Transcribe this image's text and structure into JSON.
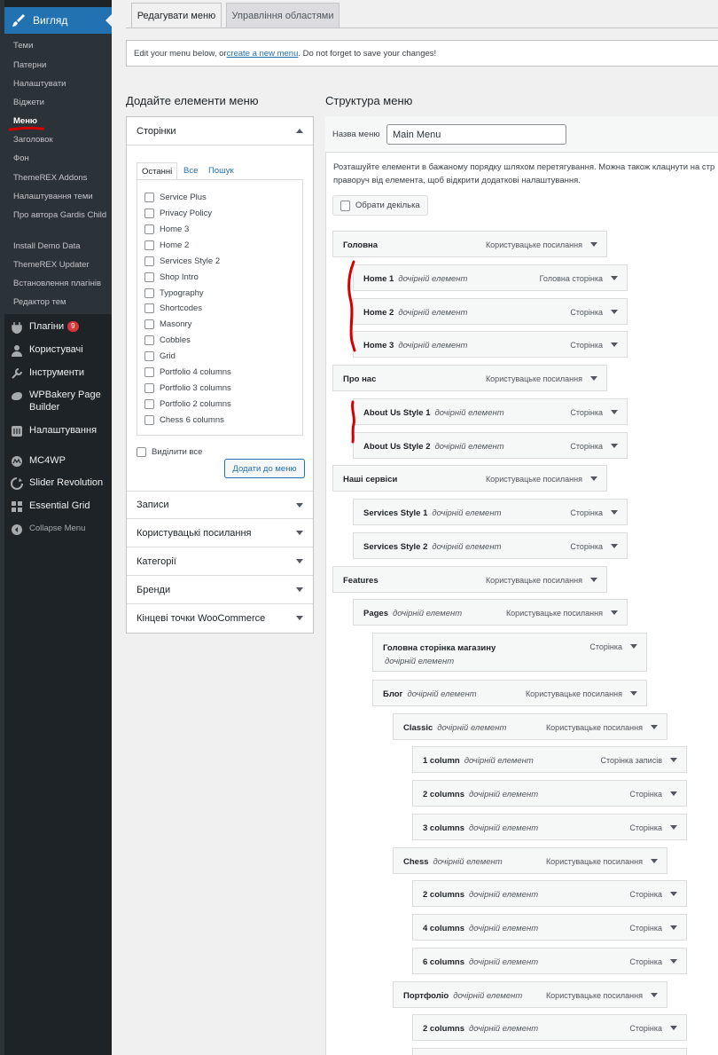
{
  "sidebar": {
    "current": "Вигляд",
    "submenu": [
      "Теми",
      "Патерни",
      "Налаштувати",
      "Віджети",
      "Меню",
      "Заголовок",
      "Фон",
      "ThemeREX Addons",
      "Налаштування теми",
      "Про автора Gardis Child",
      "Install Demo Data",
      "ThemeREX Updater",
      "Встановлення плагінів",
      "Редактор тем"
    ],
    "items": [
      {
        "label": "Плагіни",
        "badge": "9",
        "icon": "plugin-icon"
      },
      {
        "label": "Користувачі",
        "icon": "users-icon"
      },
      {
        "label": "Інструменти",
        "icon": "tools-icon"
      },
      {
        "label": "WPBakery Page Builder",
        "icon": "wpbakery-icon"
      },
      {
        "label": "Налаштування",
        "icon": "settings-icon"
      },
      {
        "label": "MC4WP",
        "icon": "mc4wp-icon"
      },
      {
        "label": "Slider Revolution",
        "icon": "slider-icon"
      },
      {
        "label": "Essential Grid",
        "icon": "grid-icon"
      },
      {
        "label": "Collapse Menu",
        "icon": "collapse-icon"
      }
    ]
  },
  "tabs": [
    "Редагувати меню",
    "Управління областями"
  ],
  "notice": {
    "before": "Edit your menu below, or ",
    "link": "create a new menu",
    "after": ". Do not forget to save your changes!"
  },
  "left": {
    "title": "Додайте елементи меню",
    "pages_header": "Сторінки",
    "inner_tabs": [
      "Останні",
      "Все",
      "Пошук"
    ],
    "pages": [
      "Service Plus",
      "Privacy Policy",
      "Home 3",
      "Home 2",
      "Services Style 2",
      "Shop Intro",
      "Typography",
      "Shortcodes",
      "Masonry",
      "Cobbles",
      "Grid",
      "Portfolio 4 columns",
      "Portfolio 3 columns",
      "Portfolio 2 columns",
      "Chess 6 columns"
    ],
    "select_all": "Виділити все",
    "add_button": "Додати до меню",
    "sections": [
      "Записи",
      "Користувацькі посилання",
      "Категорії",
      "Бренди",
      "Кінцеві точки WooCommerce"
    ]
  },
  "right": {
    "title": "Структура меню",
    "name_label": "Назва меню",
    "name_value": "Main Menu",
    "instructions_1": "Розташуйте елементи в бажаному порядку шляхом перетягування. Можна також клацнути на стр",
    "instructions_2": "праворуч від елемента, щоб відкрити додаткові налаштування.",
    "bulk_label": "Обрати декілька",
    "sub_label": "дочірній елемент",
    "items": [
      {
        "title": "Головна",
        "type": "Користувацьке посилання",
        "sub": false
      },
      {
        "title": "Home 1",
        "type": "Головна сторінка",
        "sub": true
      },
      {
        "title": "Home 2",
        "type": "Сторінка",
        "sub": true
      },
      {
        "title": "Home 3",
        "type": "Сторінка",
        "sub": true
      },
      {
        "title": "Про нас",
        "type": "Користувацьке посилання",
        "sub": false
      },
      {
        "title": "About Us Style 1",
        "type": "Сторінка",
        "sub": true
      },
      {
        "title": "About Us Style 2",
        "type": "Сторінка",
        "sub": true
      },
      {
        "title": "Наші сервіси",
        "type": "Користувацьке посилання",
        "sub": false
      },
      {
        "title": "Services Style 1",
        "type": "Сторінка",
        "sub": true
      },
      {
        "title": "Services Style 2",
        "type": "Сторінка",
        "sub": true
      },
      {
        "title": "Features",
        "type": "Користувацьке посилання",
        "sub": false
      },
      {
        "title": "Pages",
        "type": "Користувацьке посилання",
        "sub": true
      },
      {
        "title": "Головна сторінка магазину",
        "type": "Сторінка",
        "sub": true
      },
      {
        "title": "Блог",
        "type": "Користувацьке посилання",
        "sub": true
      },
      {
        "title": "Classic",
        "type": "Користувацьке посилання",
        "sub": true
      },
      {
        "title": "1 column",
        "type": "Сторінка записів",
        "sub": true
      },
      {
        "title": "2 columns",
        "type": "Сторінка",
        "sub": true
      },
      {
        "title": "3 columns",
        "type": "Сторінка",
        "sub": true
      },
      {
        "title": "Chess",
        "type": "Користувацьке посилання",
        "sub": true
      },
      {
        "title": "2 columns",
        "type": "Сторінка",
        "sub": true
      },
      {
        "title": "4 columns",
        "type": "Сторінка",
        "sub": true
      },
      {
        "title": "6 columns",
        "type": "Сторінка",
        "sub": true
      },
      {
        "title": "Портфоліо",
        "type": "Користувацьке посилання",
        "sub": true
      },
      {
        "title": "2 columns",
        "type": "Сторінка",
        "sub": true
      }
    ]
  },
  "colors": {
    "accent": "#2271b1",
    "sidebar": "#1d2327",
    "annotation": "#d40000"
  }
}
